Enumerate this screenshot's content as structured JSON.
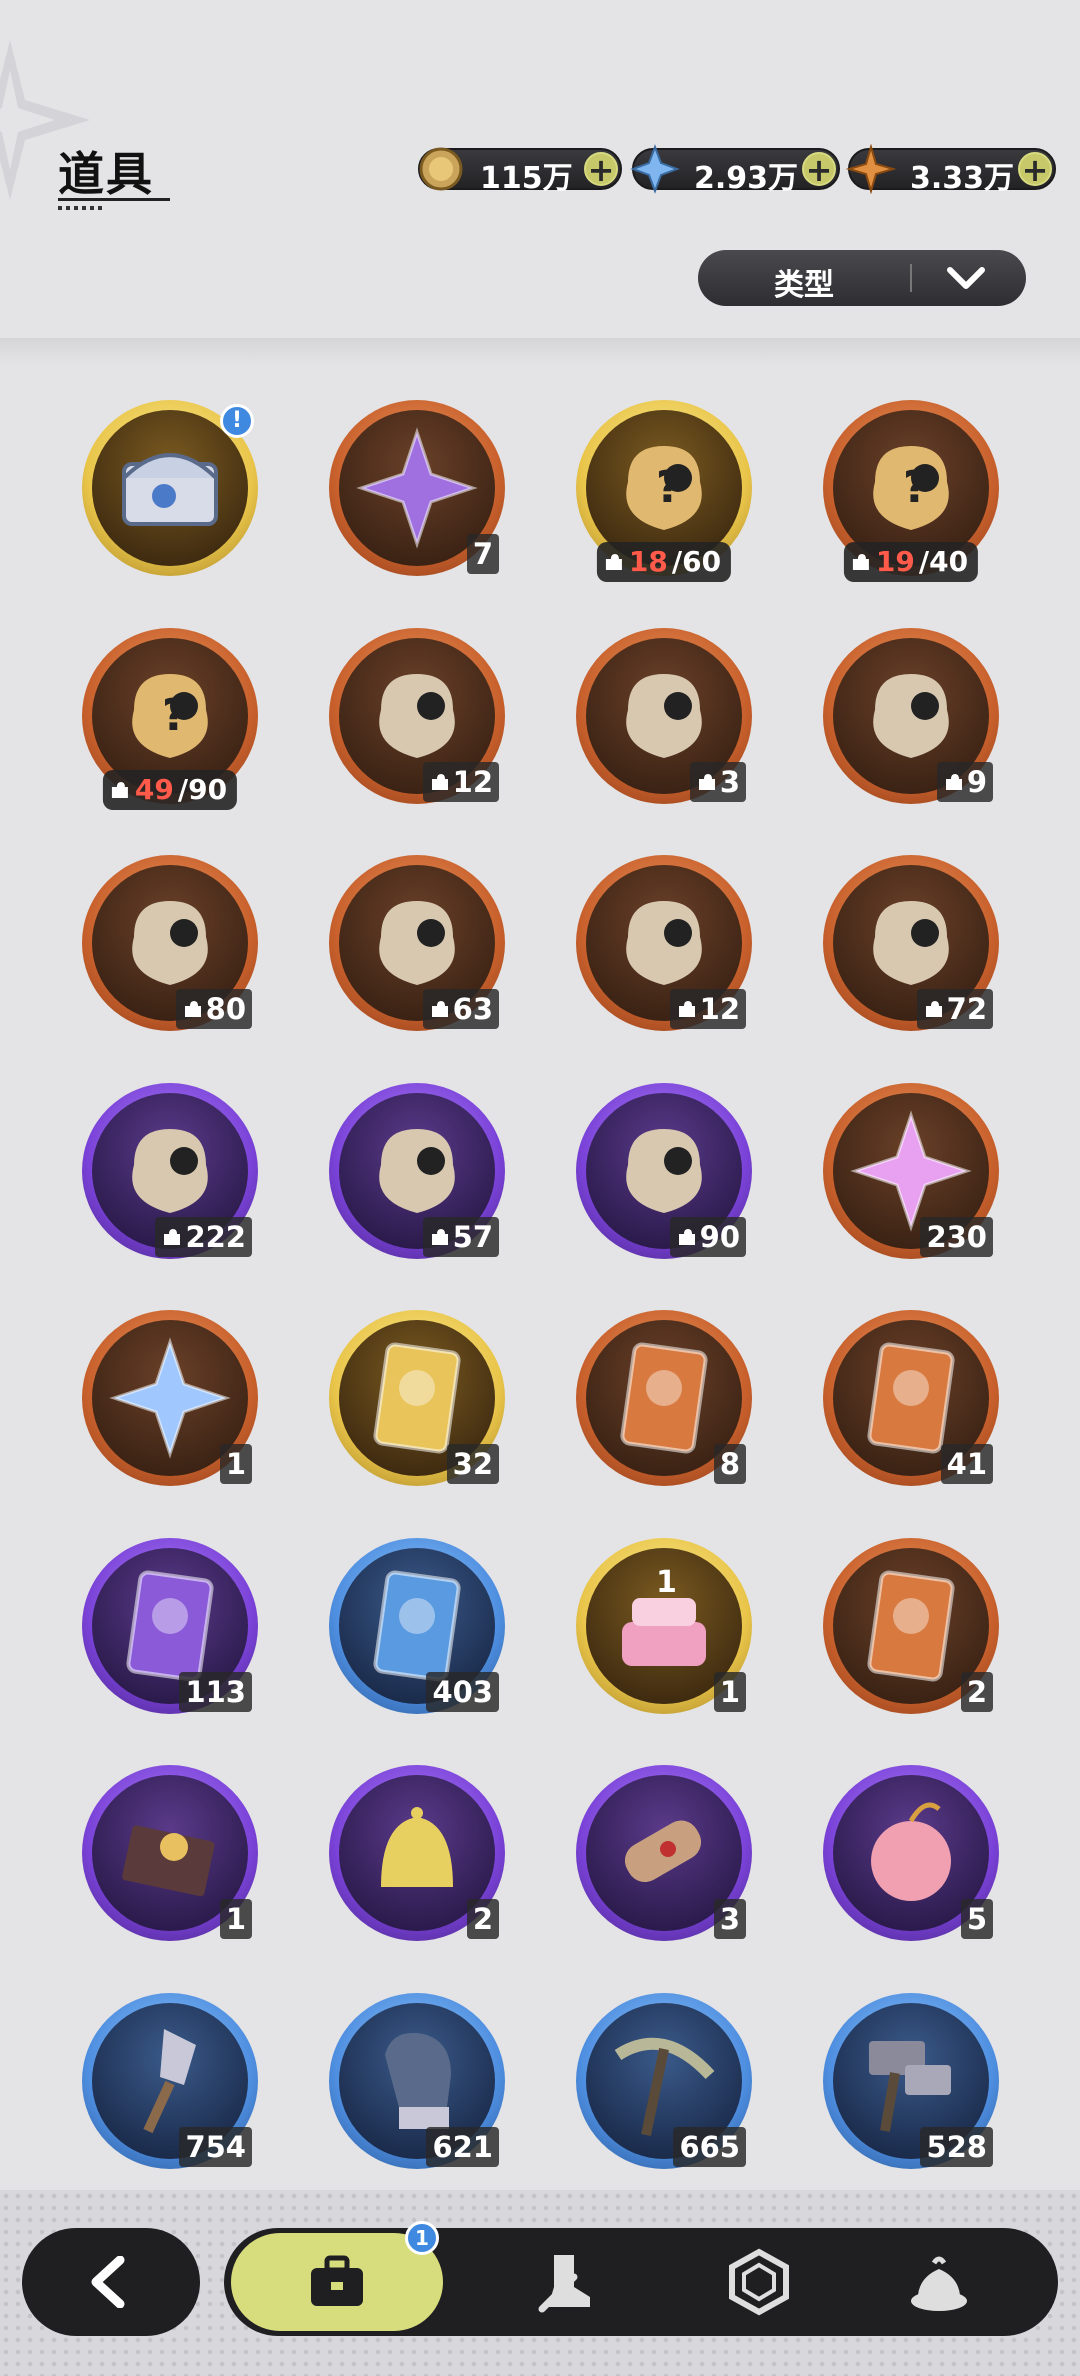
{
  "header": {
    "title": "道具"
  },
  "currencies": [
    {
      "icon": "gold-coin-icon",
      "value": "115万",
      "color": "#c9a45a"
    },
    {
      "icon": "blue-crystal-icon",
      "value": "2.93万",
      "color": "#7fb6f0"
    },
    {
      "icon": "orange-star-icon",
      "value": "3.33万",
      "color": "#e09040"
    }
  ],
  "filter": {
    "label": "类型"
  },
  "items": [
    {
      "icon": "treasure-chest-icon",
      "rarity": "gold",
      "count": "",
      "badge": "!"
    },
    {
      "icon": "purple-crystal-icon",
      "rarity": "orange",
      "count": "7"
    },
    {
      "icon": "mystery-fragment-icon",
      "rarity": "gold",
      "frag_have": "18",
      "frag_need": "/60"
    },
    {
      "icon": "mystery-fragment-icon",
      "rarity": "orange",
      "frag_have": "19",
      "frag_need": "/40"
    },
    {
      "icon": "mystery-fragment-icon",
      "rarity": "orange",
      "frag_have": "49",
      "frag_need": "/90"
    },
    {
      "icon": "white-creature-fragment-icon",
      "rarity": "orange",
      "count": "12",
      "piece": true
    },
    {
      "icon": "bear-creature-fragment-icon",
      "rarity": "orange",
      "count": "3",
      "piece": true
    },
    {
      "icon": "knight-creature-fragment-icon",
      "rarity": "orange",
      "count": "9",
      "piece": true
    },
    {
      "icon": "white-cat-fragment-icon",
      "rarity": "orange",
      "count": "80",
      "piece": true
    },
    {
      "icon": "gray-creature-fragment-icon",
      "rarity": "orange",
      "count": "63",
      "piece": true
    },
    {
      "icon": "red-eye-bear-fragment-icon",
      "rarity": "orange",
      "count": "12",
      "piece": true
    },
    {
      "icon": "purple-creature-fragment-icon",
      "rarity": "orange",
      "count": "72",
      "piece": true
    },
    {
      "icon": "green-creature-fragment-icon",
      "rarity": "purple",
      "count": "222",
      "piece": true
    },
    {
      "icon": "brown-creature-fragment-icon",
      "rarity": "purple",
      "count": "57",
      "piece": true
    },
    {
      "icon": "yellow-creature-fragment-icon",
      "rarity": "purple",
      "count": "90",
      "piece": true
    },
    {
      "icon": "pink-star-crystal-icon",
      "rarity": "orange",
      "count": "230"
    },
    {
      "icon": "blue-star-crystal-icon",
      "rarity": "orange",
      "count": "1"
    },
    {
      "icon": "gold-character-card-icon",
      "rarity": "gold",
      "count": "32"
    },
    {
      "icon": "rainbow-character-card-icon",
      "rarity": "orange",
      "count": "8"
    },
    {
      "icon": "orange-character-card-icon",
      "rarity": "orange",
      "count": "41"
    },
    {
      "icon": "purple-character-card-icon",
      "rarity": "purple",
      "count": "113"
    },
    {
      "icon": "blue-character-card-icon",
      "rarity": "blue",
      "count": "403"
    },
    {
      "icon": "birthday-cake-icon",
      "rarity": "gold",
      "count": "1"
    },
    {
      "icon": "swap-card-icon",
      "rarity": "orange",
      "count": "2"
    },
    {
      "icon": "gift-box-icon",
      "rarity": "purple",
      "count": "1"
    },
    {
      "icon": "gold-bell-icon",
      "rarity": "purple",
      "count": "2"
    },
    {
      "icon": "scroll-icon",
      "rarity": "purple",
      "count": "3"
    },
    {
      "icon": "pink-apple-icon",
      "rarity": "purple",
      "count": "5"
    },
    {
      "icon": "shovel-icon",
      "rarity": "blue",
      "count": "754"
    },
    {
      "icon": "glove-icon",
      "rarity": "blue",
      "count": "621"
    },
    {
      "icon": "pickaxe-icon",
      "rarity": "blue",
      "count": "665"
    },
    {
      "icon": "hammer-icon",
      "rarity": "blue",
      "count": "528"
    }
  ],
  "bottom_nav": {
    "back_icon": "back-arrow-icon",
    "tabs": [
      {
        "icon": "bag-icon",
        "active": true,
        "badge": "1"
      },
      {
        "icon": "sword-boot-icon",
        "active": false
      },
      {
        "icon": "gem-icon",
        "active": false
      },
      {
        "icon": "dessert-icon",
        "active": false
      }
    ]
  }
}
